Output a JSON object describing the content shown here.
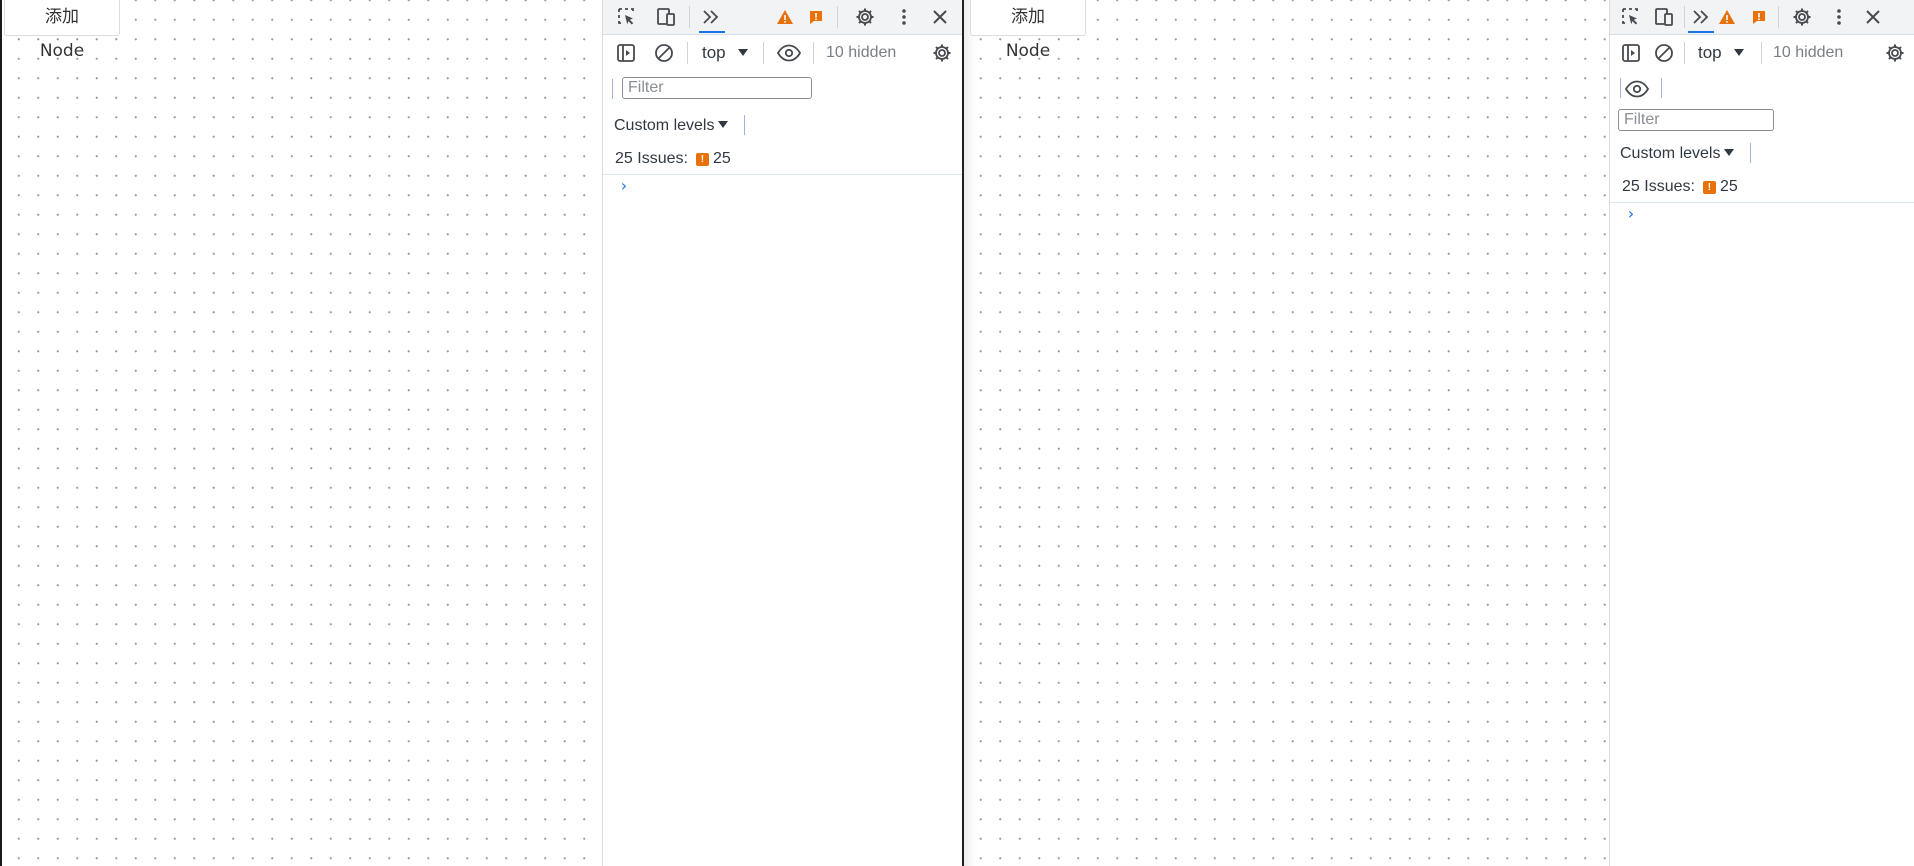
{
  "panes": [
    {
      "id": "left",
      "add_node_label": "添加Node",
      "devtools": {
        "context": "top",
        "hidden_count": "10 hidden",
        "filter_placeholder": "Filter",
        "levels_label": "Custom levels",
        "issues_label": "25 Issues:",
        "issues_count": "25",
        "prompt_symbol": "›"
      }
    },
    {
      "id": "right",
      "add_node_label": "添加Node",
      "devtools": {
        "context": "top",
        "hidden_count": "10 hidden",
        "filter_placeholder": "Filter",
        "levels_label": "Custom levels",
        "issues_label": "25 Issues:",
        "issues_count": "25",
        "prompt_symbol": "›"
      }
    }
  ],
  "colors": {
    "accent": "#1a73e8",
    "warning": "#e8710a",
    "toolbar_bg": "#f1f3f4",
    "icon": "#474b50"
  },
  "icons": [
    "inspect-element-icon",
    "device-toolbar-icon",
    "more-tabs-icon",
    "warning-icon",
    "issue-icon",
    "settings-icon",
    "more-options-icon",
    "close-icon",
    "sidebar-toggle-icon",
    "clear-console-icon",
    "eye-icon",
    "console-settings-icon"
  ]
}
